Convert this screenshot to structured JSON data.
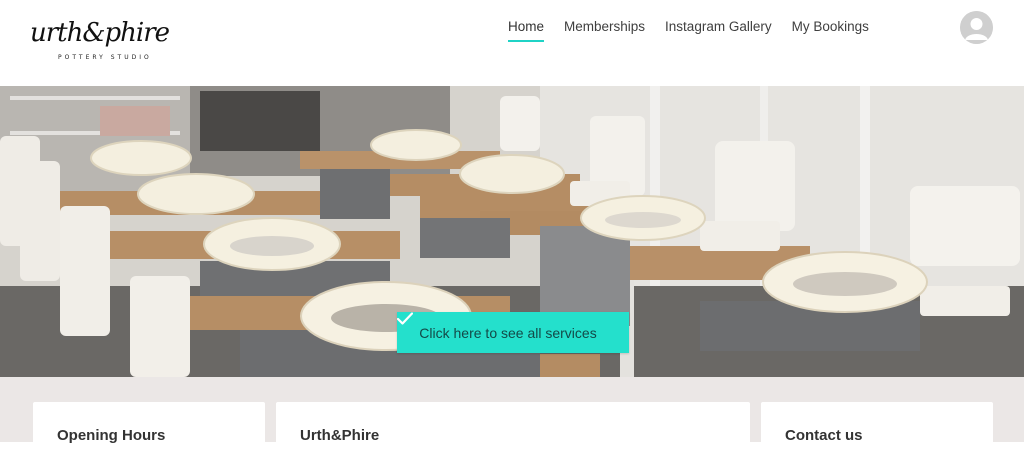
{
  "brand": {
    "logo_script": "urth&phire",
    "logo_subtitle": "POTTERY STUDIO"
  },
  "nav": {
    "items": [
      {
        "label": "Home",
        "active": true
      },
      {
        "label": "Memberships",
        "active": false
      },
      {
        "label": "Instagram Gallery",
        "active": false
      },
      {
        "label": "My Bookings",
        "active": false
      }
    ]
  },
  "user": {
    "avatar_icon": "user-avatar-icon"
  },
  "hero": {
    "cta_label": "Click here to see all services",
    "cta_icon": "checkmark-icon",
    "image_subject": "pottery-wheels-studio-photo"
  },
  "info_cards": [
    {
      "title": "Opening Hours"
    },
    {
      "title": "Urth&Phire"
    },
    {
      "title": "Contact us"
    }
  ],
  "colors": {
    "accent": "#1fd3c6",
    "cta_background": "#24e0cc",
    "info_background": "#ebe7e6"
  }
}
